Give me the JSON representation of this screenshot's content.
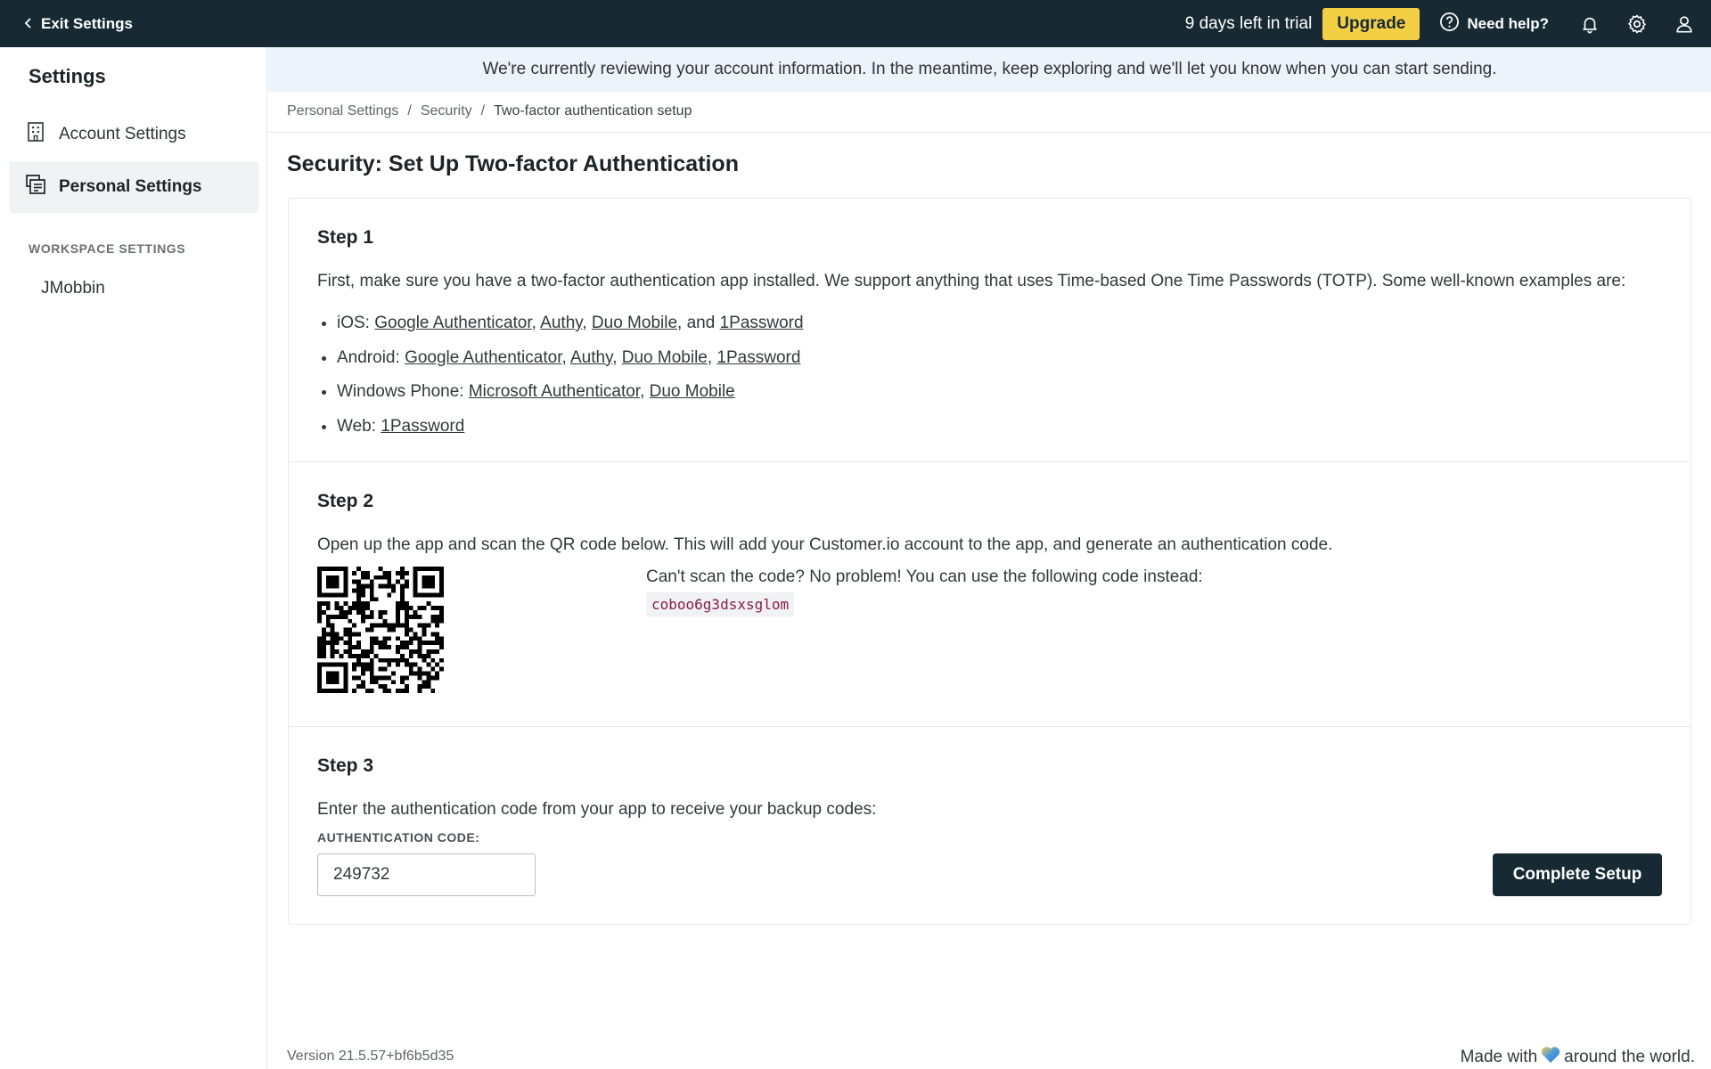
{
  "topbar": {
    "exit_label": "Exit Settings",
    "trial_text": "9 days left in trial",
    "upgrade_label": "Upgrade",
    "help_label": "Need help?",
    "background": "#172a33",
    "accent": "#f3cf45"
  },
  "sidebar": {
    "title": "Settings",
    "items": [
      {
        "label": "Account Settings",
        "icon": "building-icon"
      },
      {
        "label": "Personal Settings",
        "icon": "id-card-icon",
        "active": true
      }
    ],
    "section_label": "WORKSPACE SETTINGS",
    "workspace_name": "JMobbin"
  },
  "banner": {
    "text": "We're currently reviewing your account information. In the meantime, keep exploring and we'll let you know when you can start sending."
  },
  "breadcrumb": {
    "items": [
      "Personal Settings",
      "Security",
      "Two-factor authentication setup"
    ],
    "separator": "/"
  },
  "page": {
    "title": "Security: Set Up Two-factor Authentication"
  },
  "step1": {
    "heading": "Step 1",
    "intro": "First, make sure you have a two-factor authentication app installed. We support anything that uses Time-based One Time Passwords (TOTP). Some well-known examples are:",
    "platforms": [
      {
        "label": "iOS:",
        "apps": [
          "Google Authenticator",
          "Authy",
          "Duo Mobile",
          "1Password"
        ],
        "last_joiner": "and"
      },
      {
        "label": "Android:",
        "apps": [
          "Google Authenticator",
          "Authy",
          "Duo Mobile",
          "1Password"
        ]
      },
      {
        "label": "Windows Phone:",
        "apps": [
          "Microsoft Authenticator",
          "Duo Mobile"
        ]
      },
      {
        "label": "Web:",
        "apps": [
          "1Password"
        ]
      }
    ]
  },
  "step2": {
    "heading": "Step 2",
    "intro": "Open up the app and scan the QR code below. This will add your Customer.io account to the app, and generate an authentication code.",
    "alt_text": "Can't scan the code? No problem! You can use the following code instead:",
    "secret_code": "coboo6g3dsxsglom"
  },
  "step3": {
    "heading": "Step 3",
    "intro": "Enter the authentication code from your app to receive your backup codes:",
    "field_label": "AUTHENTICATION CODE:",
    "field_value": "249732",
    "submit_label": "Complete Setup"
  },
  "footer": {
    "version": "Version 21.5.57+bf6b5d35",
    "made_with_prefix": "Made with",
    "made_with_suffix": "around the world."
  }
}
